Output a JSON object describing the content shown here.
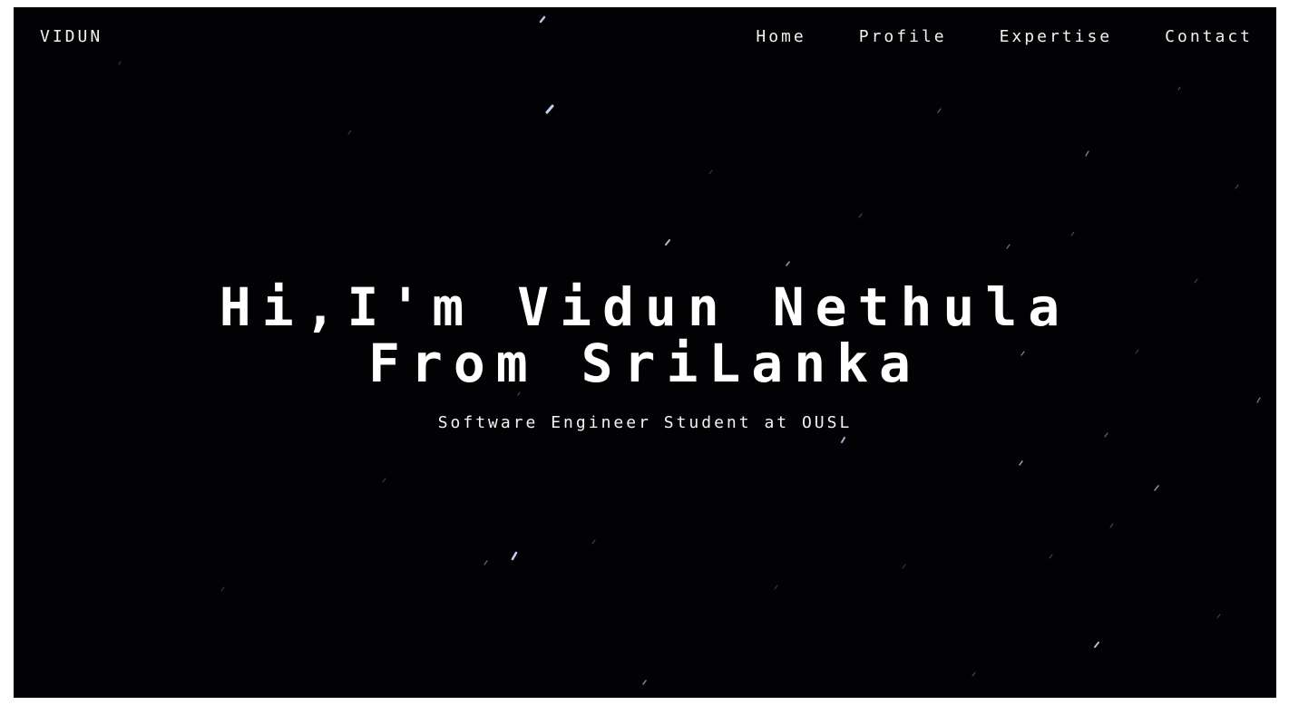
{
  "nav": {
    "logo": "VIDUN",
    "items": [
      {
        "label": "Home"
      },
      {
        "label": "Profile"
      },
      {
        "label": "Expertise"
      },
      {
        "label": "Contact"
      }
    ]
  },
  "hero": {
    "headline_line1": "Hi,I'm Vidun Nethula",
    "headline_line2": "From SriLanka",
    "subtitle": "Software Engineer Student at OUSL"
  },
  "colors": {
    "background": "#020204",
    "text": "#f2f2f2",
    "star": "#cfd8ff"
  }
}
